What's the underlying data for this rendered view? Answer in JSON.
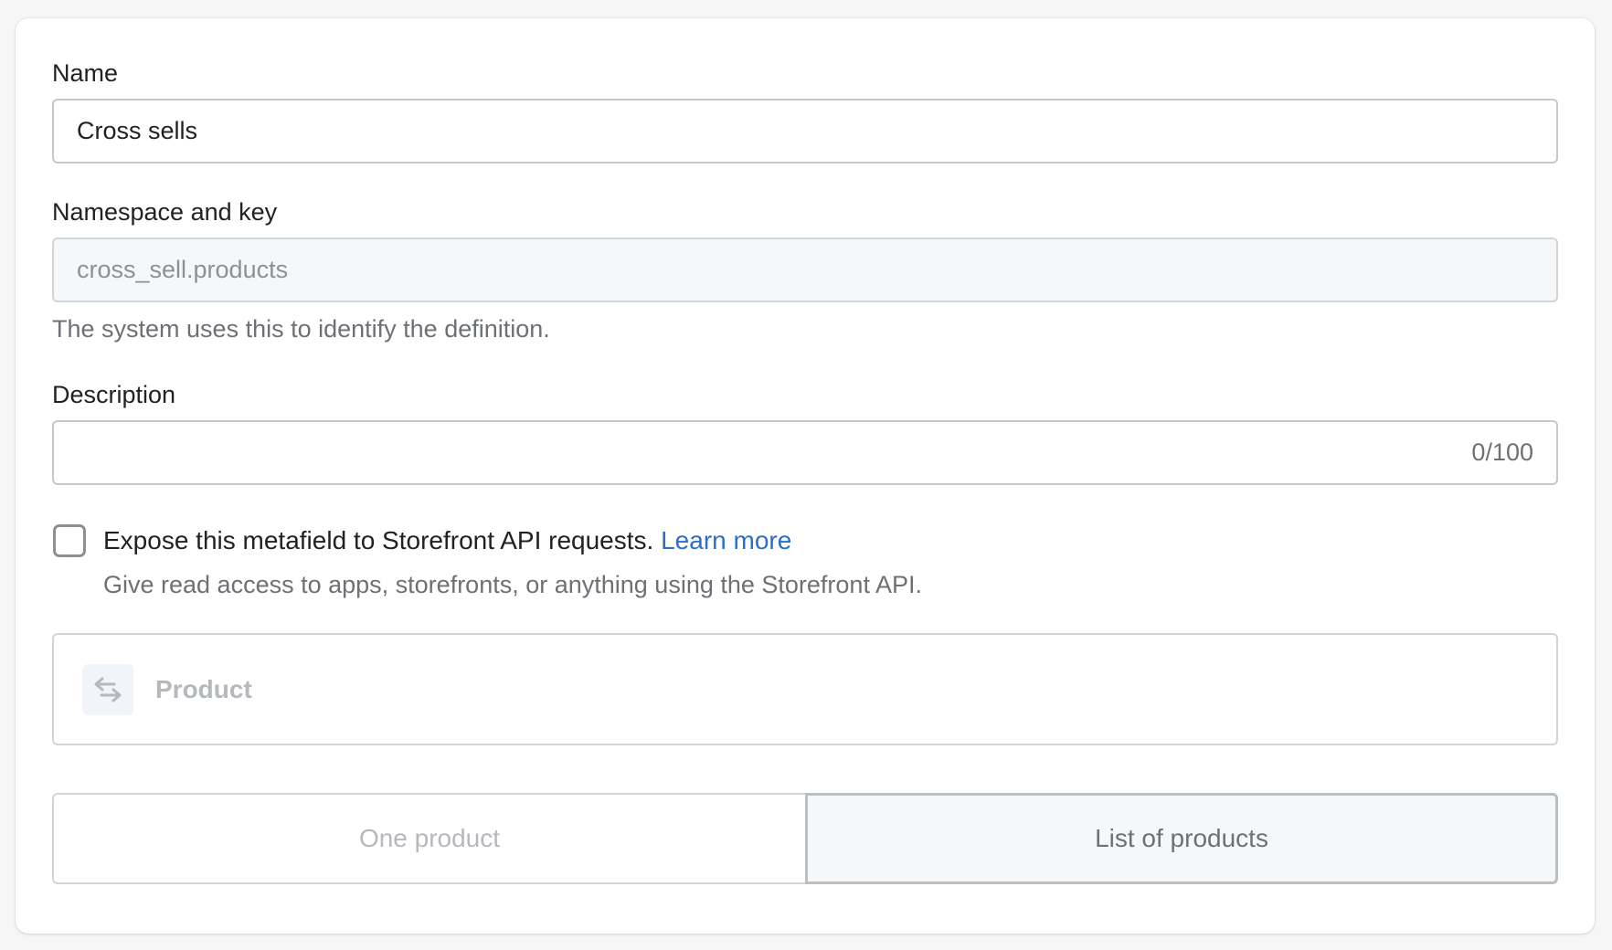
{
  "form": {
    "name": {
      "label": "Name",
      "value": "Cross sells"
    },
    "namespace": {
      "label": "Namespace and key",
      "value": "cross_sell.products",
      "help": "The system uses this to identify the definition."
    },
    "description": {
      "label": "Description",
      "value": "",
      "counter": "0/100"
    },
    "storefront": {
      "checked": false,
      "label": "Expose this metafield to Storefront API requests.",
      "link": "Learn more",
      "help": "Give read access to apps, storefronts, or anything using the Storefront API."
    },
    "type": {
      "icon": "swap-arrows-icon",
      "label": "Product"
    },
    "cardinality": {
      "options": [
        "One product",
        "List of products"
      ],
      "selected": "List of products"
    }
  },
  "colors": {
    "link": "#2c6ecb",
    "border": "#c4c7cb",
    "disabled_text": "#b5b8bd"
  }
}
